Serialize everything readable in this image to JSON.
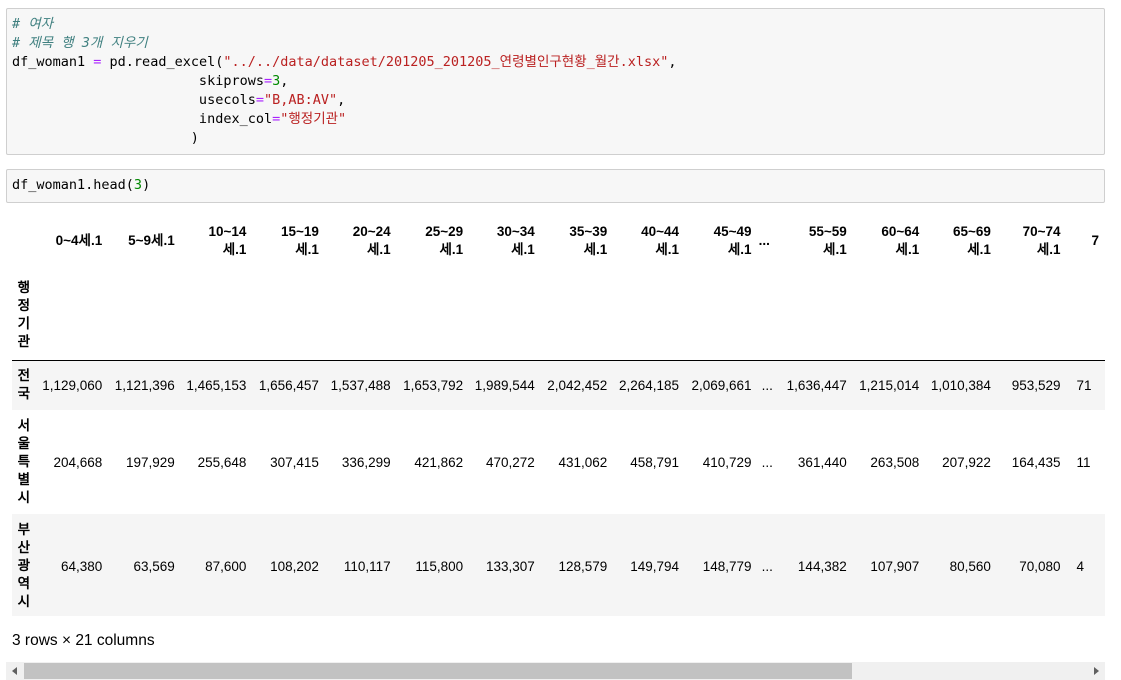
{
  "cell1": {
    "lines": [
      [
        {
          "t": "# 여자",
          "c": "cm"
        }
      ],
      [
        {
          "t": "# 제목 행 3개 지우기",
          "c": "cm"
        }
      ],
      [
        {
          "t": "df_woman1 ",
          "c": ""
        },
        {
          "t": "=",
          "c": "op"
        },
        {
          "t": " pd.read_excel(",
          "c": ""
        },
        {
          "t": "\"../../data/dataset/201205_201205_연령별인구현황_월간.xlsx\"",
          "c": "st"
        },
        {
          "t": ",",
          "c": ""
        }
      ],
      [
        {
          "t": "                       skiprows",
          "c": ""
        },
        {
          "t": "=",
          "c": "op"
        },
        {
          "t": "3",
          "c": "nu"
        },
        {
          "t": ",",
          "c": ""
        }
      ],
      [
        {
          "t": "                       usecols",
          "c": ""
        },
        {
          "t": "=",
          "c": "op"
        },
        {
          "t": "\"B,AB:AV\"",
          "c": "st"
        },
        {
          "t": ",",
          "c": ""
        }
      ],
      [
        {
          "t": "                       index_col",
          "c": ""
        },
        {
          "t": "=",
          "c": "op"
        },
        {
          "t": "\"행정기관\"",
          "c": "st"
        }
      ],
      [
        {
          "t": "                      )",
          "c": ""
        }
      ]
    ]
  },
  "cell2": {
    "lines": [
      [
        {
          "t": "df_woman1.head(",
          "c": ""
        },
        {
          "t": "3",
          "c": "nu"
        },
        {
          "t": ")",
          "c": ""
        }
      ]
    ]
  },
  "table": {
    "columns": [
      {
        "l1": "0~4세.1",
        "l2": ""
      },
      {
        "l1": "5~9세.1",
        "l2": ""
      },
      {
        "l1": "10~14",
        "l2": "세.1"
      },
      {
        "l1": "15~19",
        "l2": "세.1"
      },
      {
        "l1": "20~24",
        "l2": "세.1"
      },
      {
        "l1": "25~29",
        "l2": "세.1"
      },
      {
        "l1": "30~34",
        "l2": "세.1"
      },
      {
        "l1": "35~39",
        "l2": "세.1"
      },
      {
        "l1": "40~44",
        "l2": "세.1"
      },
      {
        "l1": "45~49",
        "l2": "세.1"
      },
      {
        "l1": "...",
        "l2": ""
      },
      {
        "l1": "55~59",
        "l2": "세.1"
      },
      {
        "l1": "60~64",
        "l2": "세.1"
      },
      {
        "l1": "65~69",
        "l2": "세.1"
      },
      {
        "l1": "70~74",
        "l2": "세.1"
      },
      {
        "l1": "7",
        "l2": ""
      }
    ],
    "index_name": "행정기관",
    "rows": [
      {
        "index": "전국",
        "values": [
          "1,129,060",
          "1,121,396",
          "1,465,153",
          "1,656,457",
          "1,537,488",
          "1,653,792",
          "1,989,544",
          "2,042,452",
          "2,264,185",
          "2,069,661",
          "...",
          "1,636,447",
          "1,215,014",
          "1,010,384",
          "953,529",
          "71"
        ]
      },
      {
        "index": "서울특별시",
        "values": [
          "204,668",
          "197,929",
          "255,648",
          "307,415",
          "336,299",
          "421,862",
          "470,272",
          "431,062",
          "458,791",
          "410,729",
          "...",
          "361,440",
          "263,508",
          "207,922",
          "164,435",
          "11"
        ]
      },
      {
        "index": "부산광역시",
        "values": [
          "64,380",
          "63,569",
          "87,600",
          "108,202",
          "110,117",
          "115,800",
          "133,307",
          "128,579",
          "149,794",
          "148,779",
          "...",
          "144,382",
          "107,907",
          "80,560",
          "70,080",
          "4"
        ]
      }
    ]
  },
  "summary": "3 rows × 21 columns"
}
